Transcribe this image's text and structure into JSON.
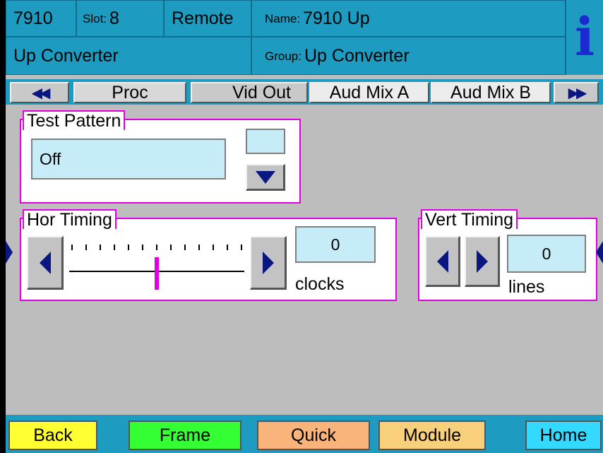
{
  "header": {
    "frame_id": "7910",
    "slot_label": "Slot:",
    "slot_value": "8",
    "mode": "Remote",
    "name_label": "Name:",
    "name_value": "7910 Up",
    "module_type": "Up Converter",
    "group_label": "Group:",
    "group_value": "Up Converter",
    "info_glyph": "i"
  },
  "tabs": {
    "scroll_left_icon": "double-left-arrow-icon",
    "scroll_right_icon": "double-right-arrow-icon",
    "items": [
      {
        "label": "Proc",
        "state": "active"
      },
      {
        "label": "Vid Out",
        "state": "normal"
      },
      {
        "label": "Aud Mix A",
        "state": "normal"
      },
      {
        "label": "Aud Mix B",
        "state": "normal"
      }
    ]
  },
  "test_pattern": {
    "title": "Test Pattern",
    "value": "Off",
    "indicator_value": ""
  },
  "hor_timing": {
    "title": "Hor Timing",
    "value": "0",
    "unit": "clocks",
    "slider_fraction": 0.5,
    "tick_count": 13
  },
  "vert_timing": {
    "title": "Vert Timing",
    "value": "0",
    "unit": "lines"
  },
  "footer": {
    "buttons": [
      {
        "label": "Back",
        "color": "#ffff33"
      },
      {
        "label": "Frame",
        "color": "#33ff33"
      },
      {
        "label": "Quick",
        "color": "#f8b47a"
      },
      {
        "label": "Module",
        "color": "#f8cf7a"
      },
      {
        "label": "Home",
        "color": "#33d9ff"
      }
    ]
  },
  "colors": {
    "header_bg": "#1e9bc0",
    "panel_bg": "#bdbdbd",
    "group_border": "#e000e0",
    "field_bg": "#c6ecf7",
    "arrow": "#0a1780",
    "slider_thumb": "#e000e0",
    "info_icon": "#1b2bd0"
  }
}
